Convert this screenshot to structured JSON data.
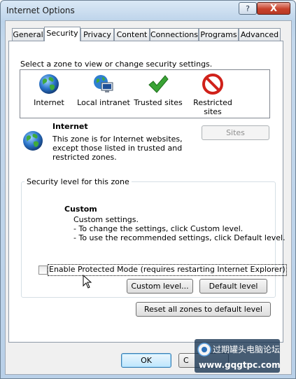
{
  "window": {
    "title": "Internet Options",
    "help_label": "?",
    "close_label": "X"
  },
  "tabs": [
    {
      "label": "General"
    },
    {
      "label": "Security"
    },
    {
      "label": "Privacy"
    },
    {
      "label": "Content"
    },
    {
      "label": "Connections"
    },
    {
      "label": "Programs"
    },
    {
      "label": "Advanced"
    }
  ],
  "active_tab": "Security",
  "zone_prompt": "Select a zone to view or change security settings.",
  "zones": [
    {
      "label": "Internet",
      "icon": "globe-icon"
    },
    {
      "label": "Local intranet",
      "icon": "intranet-icon"
    },
    {
      "label": "Trusted sites",
      "icon": "checkmark-icon"
    },
    {
      "label": "Restricted sites",
      "icon": "restricted-icon"
    }
  ],
  "selected_zone": {
    "name": "Internet",
    "description": "This zone is for Internet websites, except those listed in trusted and restricted zones.",
    "desc_lines": [
      "This zone is for Internet websites,",
      "except those listed in trusted and",
      "restricted zones."
    ],
    "sites_button": "Sites"
  },
  "security_level": {
    "group_title": "Security level for this zone",
    "level_name": "Custom",
    "lines": [
      "Custom settings.",
      "- To change the settings, click Custom level.",
      "- To use the recommended settings, click Default level."
    ]
  },
  "protected_mode": {
    "label": "Enable Protected Mode (requires restarting Internet Explorer)",
    "checked": false
  },
  "buttons": {
    "custom_level": "Custom level...",
    "default_level": "Default level",
    "reset_all": "Reset all zones to default level",
    "ok": "OK",
    "cancel_partial": "C"
  },
  "watermark": {
    "line1": "过期罐头电脑论坛",
    "line2": "www.gqgtpc.com"
  },
  "colors": {
    "title_bar": "#bcd3ea",
    "close_button": "#c7412b",
    "checkmark": "#3aa335",
    "restricted": "#d0211a"
  }
}
